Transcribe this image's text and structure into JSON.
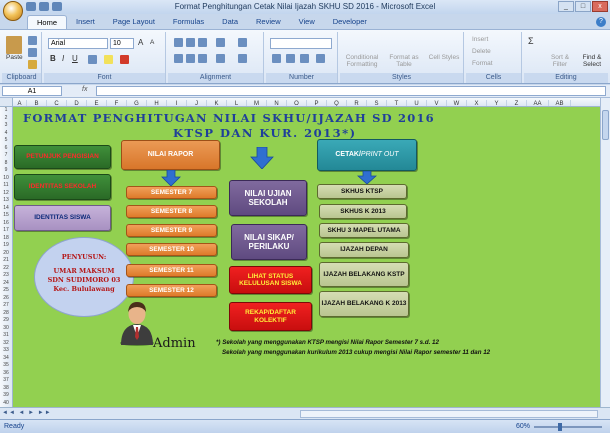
{
  "window": {
    "title": "Format Penghitungan Cetak Nilai Ijazah SKHU SD 2016 - Microsoft Excel",
    "controls": [
      "_",
      "□",
      "x"
    ]
  },
  "tabs": [
    "Home",
    "Insert",
    "Page Layout",
    "Formulas",
    "Data",
    "Review",
    "View",
    "Developer"
  ],
  "ribbon": {
    "clipboard": {
      "label": "Clipboard",
      "paste": "Paste"
    },
    "font": {
      "label": "Font",
      "name": "Arial",
      "size": "10",
      "grow": "A",
      "shrink": "A"
    },
    "alignment": {
      "label": "Alignment"
    },
    "number": {
      "label": "Number"
    },
    "styles": {
      "label": "Styles",
      "cond_format": "Conditional Formatting",
      "format_table": "Format as Table",
      "cell_styles": "Cell Styles"
    },
    "cells": {
      "label": "Cells",
      "insert": "Insert",
      "delete": "Delete",
      "format": "Format"
    },
    "editing": {
      "label": "Editing",
      "sum": "Σ",
      "sort": "Sort & Filter",
      "find": "Find & Select"
    }
  },
  "formula_bar": {
    "name_box": "A1",
    "fx": "fx",
    "value": ""
  },
  "columns": [
    "A",
    "B",
    "C",
    "D",
    "E",
    "F",
    "G",
    "H",
    "I",
    "J",
    "K",
    "L",
    "M",
    "N",
    "O",
    "P",
    "Q",
    "R",
    "S",
    "T",
    "U",
    "V",
    "W",
    "X",
    "Y",
    "Z",
    "AA",
    "AB"
  ],
  "rows": [
    "1",
    "2",
    "3",
    "4",
    "5",
    "6",
    "7",
    "8",
    "9",
    "10",
    "11",
    "12",
    "13",
    "14",
    "15",
    "16",
    "17",
    "18",
    "19",
    "20",
    "21",
    "22",
    "23",
    "24",
    "25",
    "26",
    "27",
    "28",
    "29",
    "30",
    "31",
    "32",
    "33",
    "34",
    "35",
    "36",
    "37",
    "38",
    "39",
    "40"
  ],
  "sheet": {
    "title_line1": "FORMAT PENGHITUGAN NILAI SKHU/IJAZAH SD  2016",
    "title_line2": "KTSP DAN KUR. 2013*)",
    "left_buttons": [
      "PETUNJUK PENGISIAN",
      "IDENTITAS SEKOLAH",
      "IDENTITAS SISWA"
    ],
    "nilai_rapor": "NILAI RAPOR",
    "semesters": [
      "SEMESTER 7",
      "SEMESTER 8",
      "SEMESTER 9",
      "SEMESTER 10",
      "SEMESTER 11",
      "SEMESTER 12"
    ],
    "ujian": "NILAI UJIAN SEKOLAH",
    "sikap": "NILAI SIKAP/ PERILAKU",
    "status": "LIHAT STATUS KELULUSAN  SISWA",
    "rekap": "REKAP/DAFTAR KOLEKTIF",
    "cetak_prefix": "CETAK/ ",
    "cetak_suffix": "PRINT OUT",
    "print_buttons": [
      "SKHUS KTSP",
      "SKHUS K 2013",
      "SKHU 3 MAPEL UTAMA",
      "IJAZAH DEPAN",
      "IJAZAH BELAKANG KSTP",
      "IJAZAH BELAKANG K 2013"
    ],
    "penyusun_title": "PENYUSUN:",
    "penyusun_name": "UMAR MAKSUM",
    "penyusun_school": "SDN SUDIMORO 03",
    "penyusun_place": "Kec. Bululawang",
    "admin": "Admin",
    "note1": "*) Sekolah yang menggunakan  KTSP mengisi Nilai Rapor Semester 7 s.d. 12",
    "note2": "Sekolah yang menggunakan kurikulum 2013 cukup mengisi Nilai Rapor semester 11 dan 12"
  },
  "status_bar": {
    "ready": "Ready",
    "zoom": "60%"
  },
  "colors": {
    "sheet_bg": "#92d050",
    "title": "#1f3f9a"
  }
}
